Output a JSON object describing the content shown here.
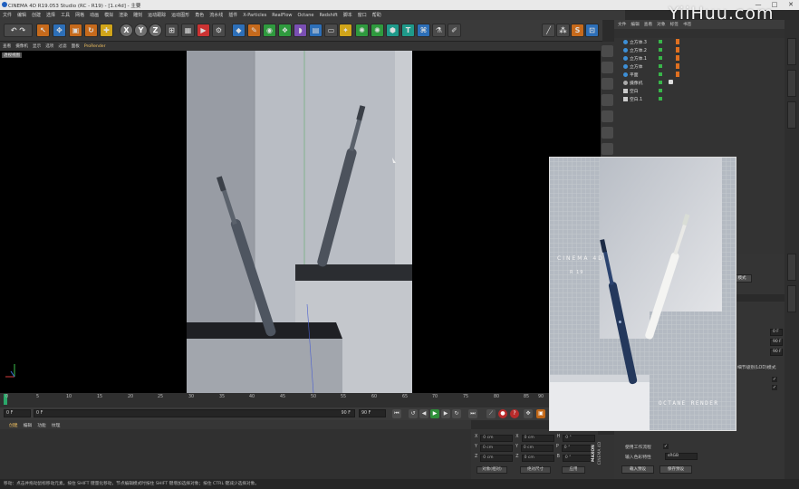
{
  "window": {
    "title": "CINEMA 4D R19.053 Studio (RC - R19) - [1.c4d] - 主要",
    "controls": [
      "—",
      "□",
      "✕"
    ]
  },
  "watermark": "YiiHuu.com",
  "menu": [
    "文件",
    "编辑",
    "创建",
    "选择",
    "工具",
    "网格",
    "动画",
    "模拟",
    "渲染",
    "雕刻",
    "运动跟踪",
    "运动图形",
    "角色",
    "流水线",
    "插件",
    "X-Particles",
    "RealFlow",
    "Octane",
    "Redshift",
    "脚本",
    "窗口",
    "帮助"
  ],
  "toolbar": {
    "axes": [
      "X",
      "Y",
      "Z"
    ]
  },
  "viewport": {
    "menu": [
      "查看",
      "摄像机",
      "显示",
      "选项",
      "过滤",
      "面板",
      "ProRender"
    ],
    "label": "透视视图"
  },
  "timeline": {
    "ticks": [
      "0",
      "5",
      "10",
      "15",
      "20",
      "25",
      "30",
      "35",
      "40",
      "45",
      "50",
      "55",
      "60",
      "65",
      "70",
      "75",
      "80",
      "85",
      "90"
    ],
    "end_label": "0 F"
  },
  "transport": {
    "start_frame": "0 F",
    "current_frame": "0 F",
    "range_end": "90 F",
    "end_frame": "90 F"
  },
  "bottom_tabs": [
    "创建",
    "编辑",
    "功能",
    "纹理"
  ],
  "coords": {
    "rows": [
      {
        "axis": "X",
        "pos": "0 cm",
        "axis2": "X",
        "size": "0 cm",
        "axis3": "H",
        "rot": "0 °"
      },
      {
        "axis": "Y",
        "pos": "0 cm",
        "axis2": "Y",
        "size": "0 cm",
        "axis3": "P",
        "rot": "0 °"
      },
      {
        "axis": "Z",
        "pos": "0 cm",
        "axis2": "Z",
        "size": "0 cm",
        "axis3": "B",
        "rot": "0 °"
      }
    ],
    "mode": "对象(相对)",
    "size_mode": "绝对尺寸",
    "apply": "应用"
  },
  "status": "移动：点击并拖动鼠标移动元素。按住 SHIFT 键量化移动，节点编辑模式时按住 SHIFT 键增加选择对象；按住 CTRL 键减少选择对象。",
  "objects": {
    "header": [
      "文件",
      "编辑",
      "查看",
      "对象",
      "标签",
      "书签"
    ],
    "items": [
      {
        "name": "立方体.3"
      },
      {
        "name": "立方体.2"
      },
      {
        "name": "立方体.1"
      },
      {
        "name": "立方体"
      },
      {
        "name": "平面"
      },
      {
        "name": "摄像机"
      },
      {
        "name": "空白"
      },
      {
        "name": "空白.1"
      }
    ]
  },
  "attributes": {
    "mode_button": "模式",
    "fields": [
      "0 F",
      "90 F",
      "90 F"
    ],
    "lod_label": "细节级别(LOD)模式",
    "render_label": "使用工作流程",
    "color_label": "输入色彩特性",
    "color_value": "sRGB",
    "btn_left": "载入预设",
    "btn_right": "保存预设"
  },
  "overlay": {
    "top_text": "CINEMA 4D",
    "sub_text": "R 19",
    "bottom_text": "OCTANE RENDER"
  },
  "maxon": {
    "line1": "MAXON",
    "line2": "CINEMA 4D"
  }
}
